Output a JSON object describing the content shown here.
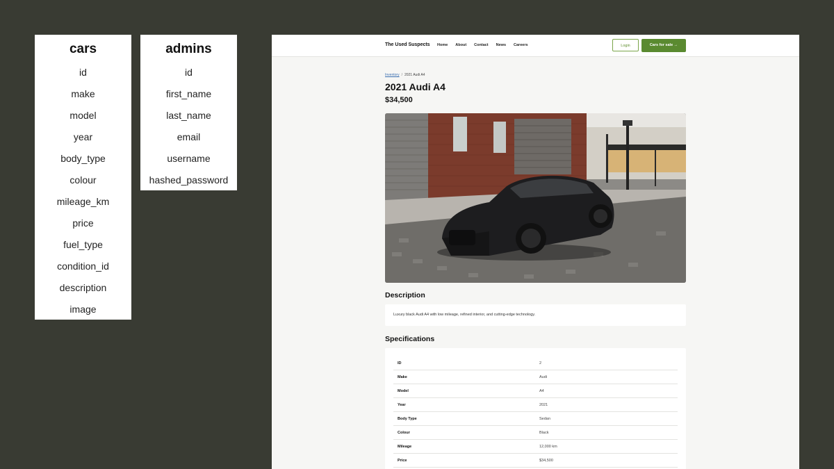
{
  "schemas": {
    "cars": {
      "title": "cars",
      "fields": [
        "id",
        "make",
        "model",
        "year",
        "body_type",
        "colour",
        "mileage_km",
        "price",
        "fuel_type",
        "condition_id",
        "description",
        "image"
      ]
    },
    "admins": {
      "title": "admins",
      "fields": [
        "id",
        "first_name",
        "last_name",
        "email",
        "username",
        "hashed_password"
      ]
    }
  },
  "site": {
    "brand": "The Used Suspects",
    "nav": [
      "Home",
      "About",
      "Contact",
      "News",
      "Careers"
    ],
    "login_label": "Login",
    "cars_for_sale_label": "Cars for sale →",
    "accent_color": "#5a8a30"
  },
  "car": {
    "breadcrumb_link": "Inventory",
    "breadcrumb_sep": "/",
    "breadcrumb_current": "2021 Audi A4",
    "title": "2021 Audi A4",
    "price": "$34,500",
    "description_heading": "Description",
    "description": "Luxury black Audi A4 with low mileage, refined interior, and cutting-edge technology.",
    "specs_heading": "Specifications",
    "specs": [
      {
        "label": "ID",
        "value": "2"
      },
      {
        "label": "Make",
        "value": "Audi"
      },
      {
        "label": "Model",
        "value": "A4"
      },
      {
        "label": "Year",
        "value": "2021"
      },
      {
        "label": "Body Type",
        "value": "Sedan"
      },
      {
        "label": "Colour",
        "value": "Black"
      },
      {
        "label": "Mileage",
        "value": "12,000 km"
      },
      {
        "label": "Price",
        "value": "$34,500"
      }
    ]
  }
}
